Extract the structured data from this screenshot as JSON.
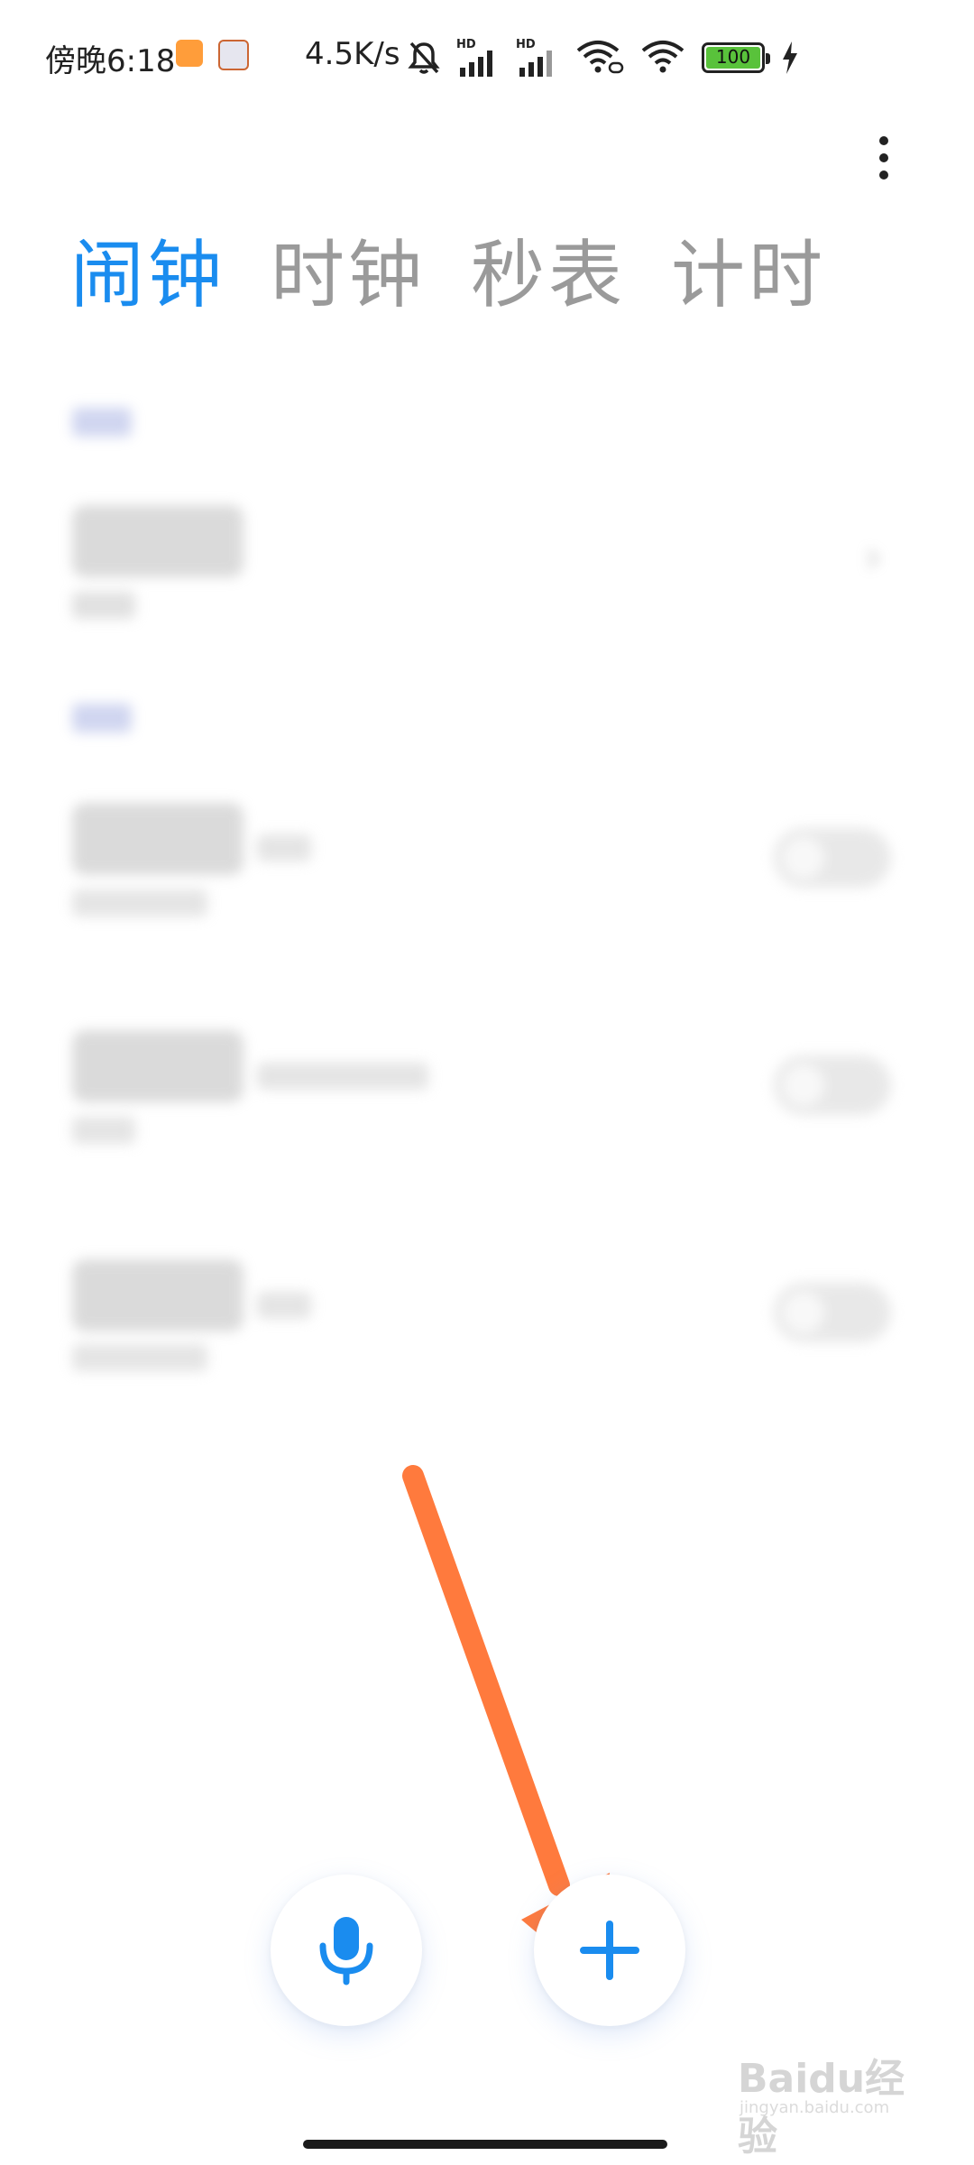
{
  "status_bar": {
    "time": "傍晚6:18",
    "net_speed": "4.5K/s",
    "battery_level": "100",
    "hd_label": "HD"
  },
  "tabs": [
    {
      "label": "闹钟",
      "active": true
    },
    {
      "label": "时钟",
      "active": false
    },
    {
      "label": "秒表",
      "active": false
    },
    {
      "label": "计时",
      "active": false
    }
  ],
  "colors": {
    "accent": "#1a8cef",
    "arrow": "#ff7a3d",
    "battery": "#59c23b"
  },
  "watermark": {
    "logo": "Baidu经验",
    "sub": "jingyan.baidu.com"
  },
  "icons": {
    "more": "more-vertical-icon",
    "mic": "microphone-icon",
    "add": "plus-icon"
  }
}
